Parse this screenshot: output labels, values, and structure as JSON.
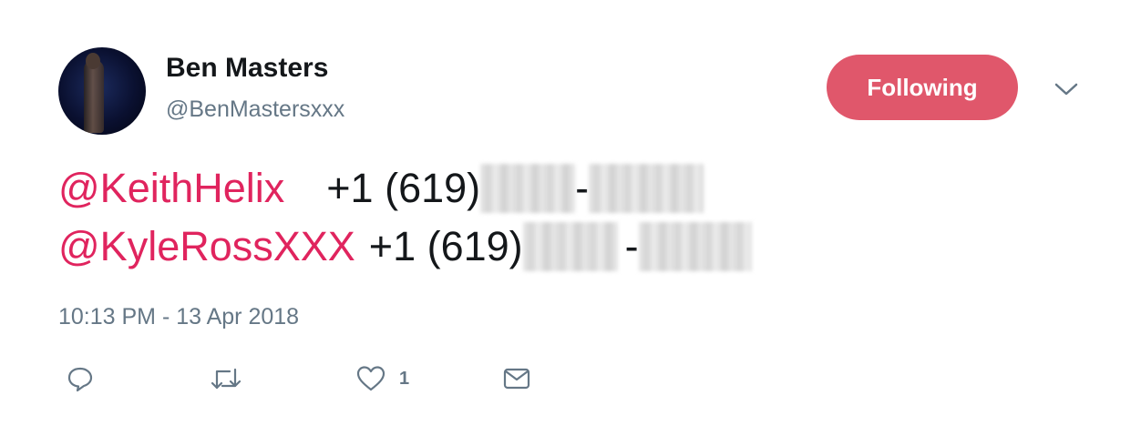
{
  "author": {
    "display_name": "Ben Masters",
    "handle": "@BenMastersxxx"
  },
  "follow_button": {
    "label": "Following",
    "color": "#e0576b"
  },
  "tweet": {
    "lines": [
      {
        "mention": "@KeithHelix",
        "phone_prefix": "+1 (619)",
        "separator": "-"
      },
      {
        "mention": "@KyleRossXXX",
        "phone_prefix": "+1 (619)",
        "separator": "-"
      }
    ],
    "timestamp": "10:13 PM - 13 Apr 2018"
  },
  "actions": {
    "reply_icon": "reply-icon",
    "retweet_icon": "retweet-icon",
    "like_icon": "heart-icon",
    "like_count": "1",
    "dm_icon": "envelope-icon"
  },
  "colors": {
    "mention": "#e0245e",
    "muted": "#657786",
    "text": "#14171a"
  }
}
